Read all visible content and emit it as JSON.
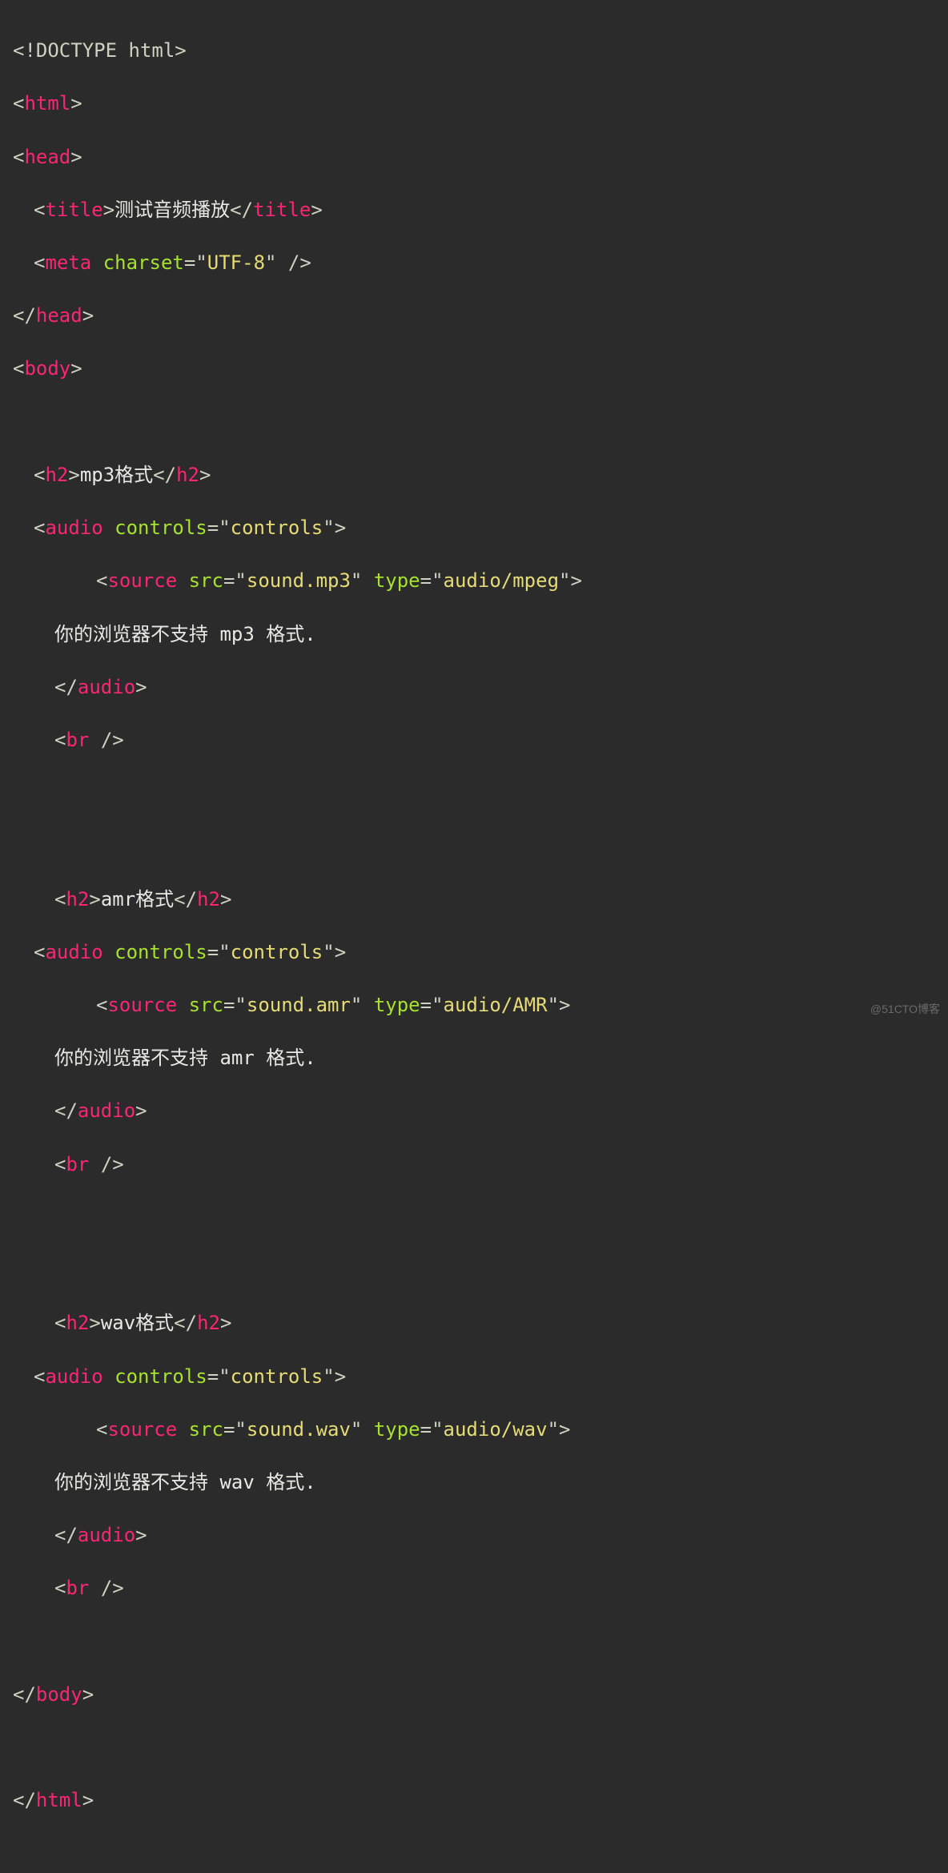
{
  "watermark": "@51CTO博客",
  "code": {
    "doctype": "<!DOCTYPE html>",
    "title_text": "测试音频播放",
    "meta_charset": "UTF-8",
    "sections": [
      {
        "heading": "mp3格式",
        "src": "sound.mp3",
        "type": "audio/mpeg",
        "fallback": "你的浏览器不支持 mp3 格式."
      },
      {
        "heading": "amr格式",
        "src": "sound.amr",
        "type": "audio/AMR",
        "fallback": "你的浏览器不支持 amr 格式."
      },
      {
        "heading": "wav格式",
        "src": "sound.wav",
        "type": "audio/wav",
        "fallback": "你的浏览器不支持 wav 格式."
      }
    ],
    "tags": {
      "html": "html",
      "head": "head",
      "title": "title",
      "meta": "meta",
      "body": "body",
      "h2": "h2",
      "audio": "audio",
      "source": "source",
      "br": "br"
    },
    "attrs": {
      "charset": "charset",
      "controls": "controls",
      "src": "src",
      "type": "type"
    },
    "controls_value": "controls"
  }
}
